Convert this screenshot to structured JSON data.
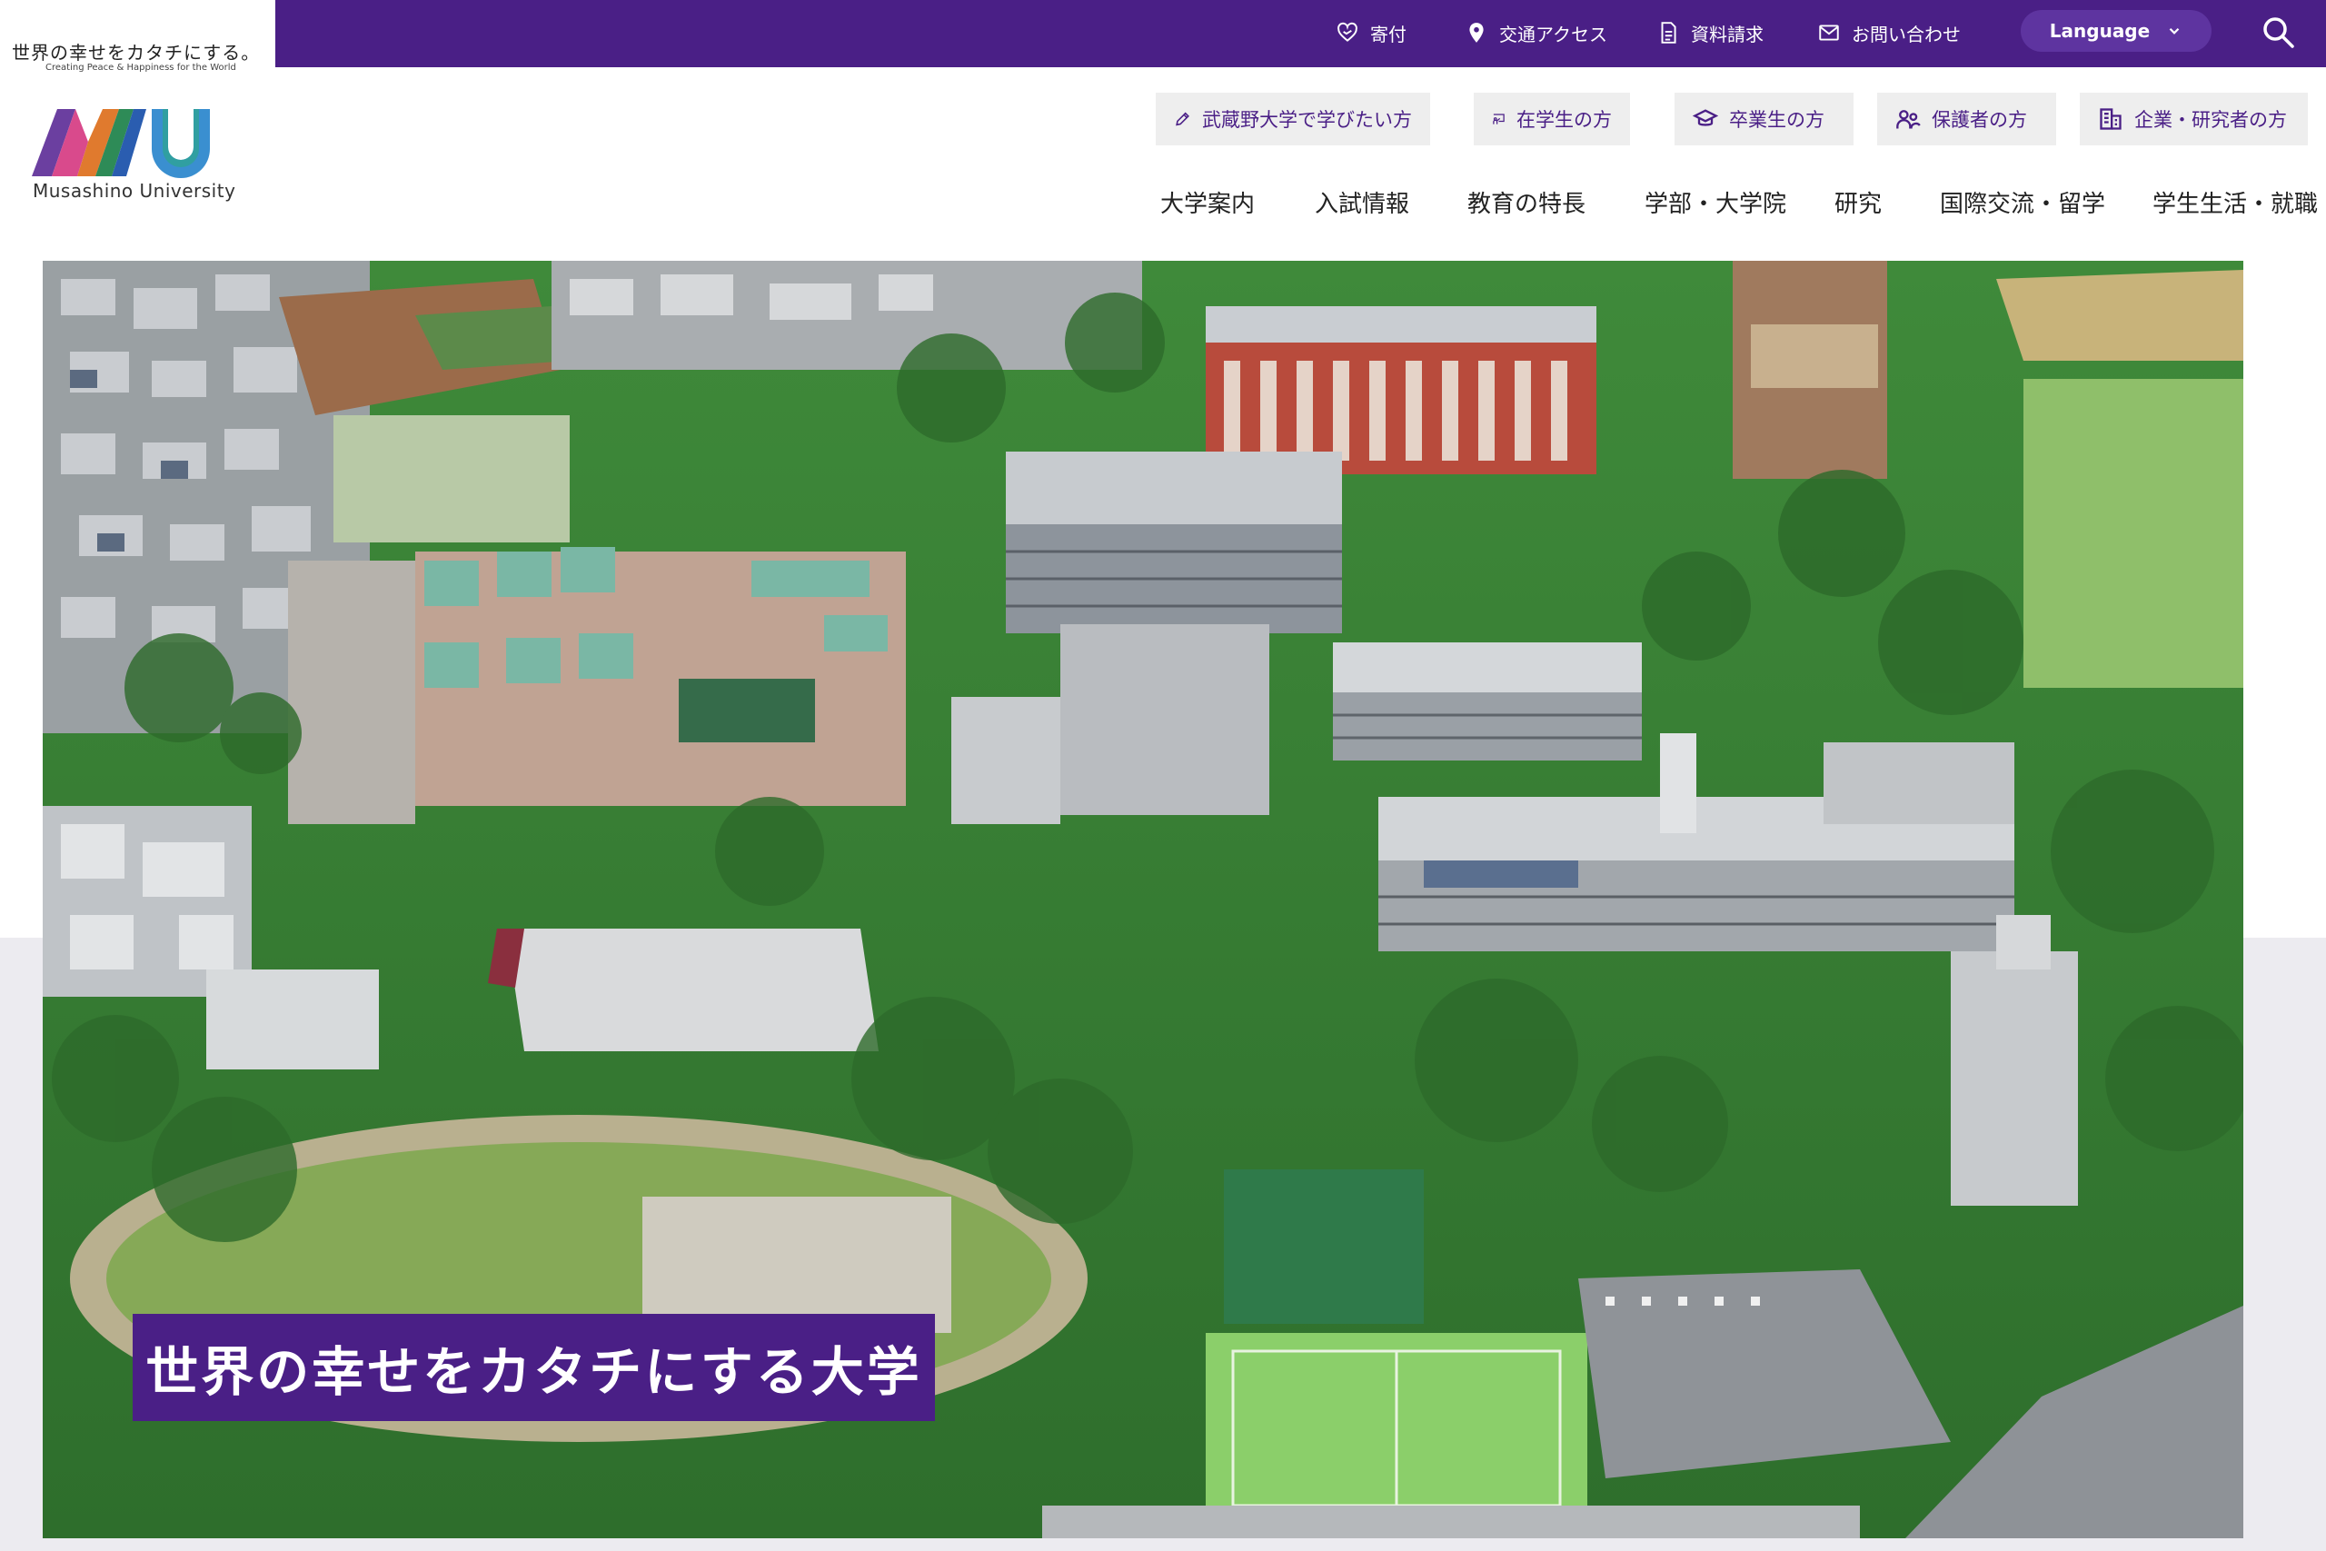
{
  "tagline": {
    "jp": "世界の幸せをカタチにする。",
    "en": "Creating Peace & Happiness for the World"
  },
  "utility": {
    "donate": "寄付",
    "access": "交通アクセス",
    "materials": "資料請求",
    "contact": "お問い合わせ",
    "language": "Language"
  },
  "logo": {
    "text": "Musashino University"
  },
  "audience": [
    {
      "label": "武蔵野大学で学びたい方",
      "icon": "pencil-icon"
    },
    {
      "label": "在学生の方",
      "icon": "presentation-icon"
    },
    {
      "label": "卒業生の方",
      "icon": "graduation-cap-icon"
    },
    {
      "label": "保護者の方",
      "icon": "people-icon"
    },
    {
      "label": "企業・研究者の方",
      "icon": "building-icon"
    }
  ],
  "nav": [
    "大学案内",
    "入試情報",
    "教育の特長",
    "学部・大学院",
    "研究",
    "国際交流・留学",
    "学生生活・就職"
  ],
  "hero": {
    "caption": "世界の幸せをカタチにする大学"
  },
  "colors": {
    "brand_purple": "#4a1f86",
    "button_gray": "#eeeeee",
    "hero_bg": "#ecebf0"
  }
}
